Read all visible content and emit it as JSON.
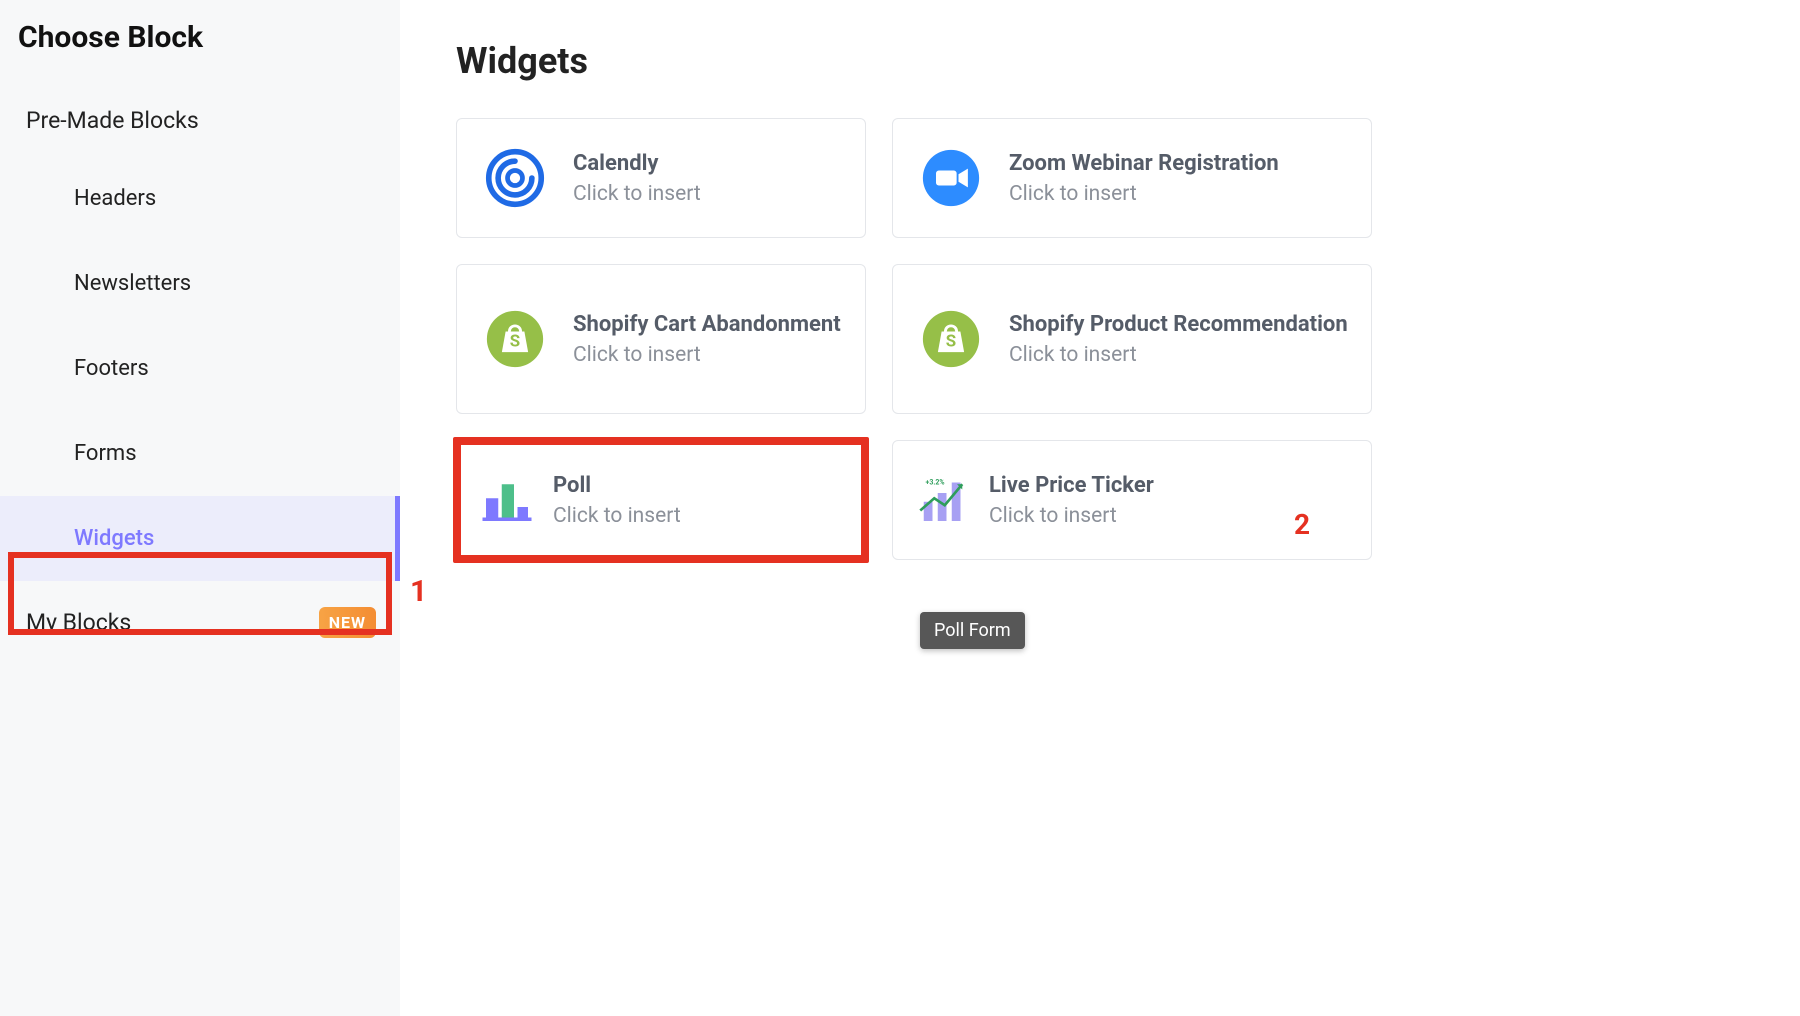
{
  "sidebar": {
    "title": "Choose Block",
    "category_premade": "Pre-Made Blocks",
    "items": [
      {
        "label": "Headers"
      },
      {
        "label": "Newsletters"
      },
      {
        "label": "Footers"
      },
      {
        "label": "Forms"
      },
      {
        "label": "Widgets",
        "active": true
      }
    ],
    "my_blocks_label": "My Blocks",
    "new_badge": "NEW"
  },
  "main": {
    "title": "Widgets",
    "click_label": "Click to insert",
    "cards": [
      {
        "title": "Calendly",
        "icon": "calendly"
      },
      {
        "title": "Zoom Webinar Registration",
        "icon": "zoom"
      },
      {
        "title": "Shopify Cart Abandonment",
        "icon": "shopify"
      },
      {
        "title": "Shopify Product Recommendation",
        "icon": "shopify"
      },
      {
        "title": "Poll",
        "icon": "poll",
        "highlight": true
      },
      {
        "title": "Live Price Ticker",
        "icon": "ticker"
      }
    ]
  },
  "tooltip": "Poll Form",
  "annotations": {
    "one": "1",
    "two": "2"
  },
  "colors": {
    "accent": "#7e79ff",
    "highlight": "#e53121",
    "shopify": "#96bf48",
    "zoom": "#2d8cff",
    "calendly": "#1f6ae5"
  }
}
